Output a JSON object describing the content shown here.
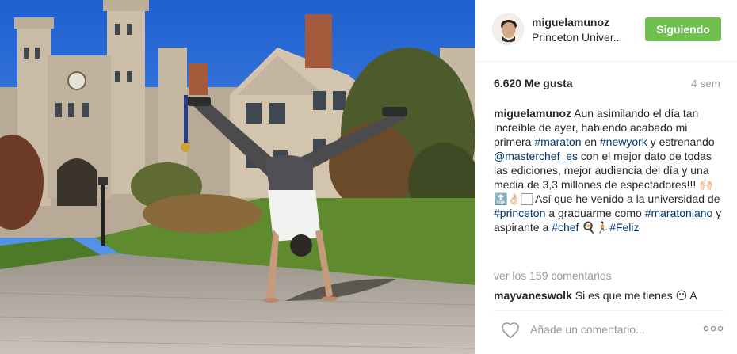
{
  "post": {
    "username": "miguelamunoz",
    "location": "Princeton Univer...",
    "follow_label": "Siguiendo",
    "likes": "6.620 Me gusta",
    "time_ago": "4 sem"
  },
  "caption": {
    "user": "miguelamunoz",
    "t1": " Aun asimilando el día tan increíble de ayer, habiendo acabado mi primera ",
    "tag_maraton": "#maraton",
    "t2": " en ",
    "tag_newyork": "#newyork",
    "t3": " y estrenando ",
    "mention_masterchef": "@masterchef_es",
    "t4": " con el mejor dato de todas las ediciones, mejor audiencia del día y una media de 3,3 millones de espectadores!!! 🙌🏻🔝👌🏻🏻 Así que he venido a la universidad de ",
    "tag_princeton": "#princeton",
    "t5": " a graduarme como ",
    "tag_maratoniano": "#maratoniano",
    "t6": " y aspirante a ",
    "tag_chef": "#chef",
    "t7": " 🍳🏃🏻",
    "tag_feliz": "#Feliz"
  },
  "comments": {
    "view_all_label": "ver los 159 comentarios",
    "first": {
      "user": "mayvaneswolk",
      "text": " Si es que me tienes 😶 A"
    }
  },
  "footer": {
    "placeholder": "Añade un comentario...",
    "heart_icon": "heart-outline-icon",
    "more_icon": "more-options-icon"
  },
  "colors": {
    "follow_bg": "#70c050",
    "tag": "#003569",
    "muted": "#999999"
  }
}
